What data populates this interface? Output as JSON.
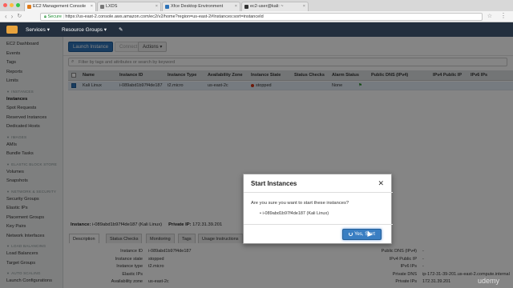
{
  "browser": {
    "tabs": [
      {
        "label": "EC2 Management Console"
      },
      {
        "label": "LXDS"
      },
      {
        "label": "Xfce Desktop Environment"
      },
      {
        "label": "ec2-user@kali: ~"
      }
    ],
    "secure_label": "Secure",
    "url": "https://us-east-2.console.aws.amazon.com/ec2/v2/home?region=us-east-2#Instances:sort=instanceId"
  },
  "aws_header": {
    "services": "Services",
    "resource_groups": "Resource Groups"
  },
  "sidebar": {
    "top_items": [
      "EC2 Dashboard",
      "Events",
      "Tags",
      "Reports",
      "Limits"
    ],
    "sections": [
      {
        "title": "INSTANCES",
        "items": [
          "Instances",
          "Spot Requests",
          "Reserved Instances",
          "Dedicated Hosts"
        ]
      },
      {
        "title": "IMAGES",
        "items": [
          "AMIs",
          "Bundle Tasks"
        ]
      },
      {
        "title": "ELASTIC BLOCK STORE",
        "items": [
          "Volumes",
          "Snapshots"
        ]
      },
      {
        "title": "NETWORK & SECURITY",
        "items": [
          "Security Groups",
          "Elastic IPs",
          "Placement Groups",
          "Key Pairs",
          "Network Interfaces"
        ]
      },
      {
        "title": "LOAD BALANCING",
        "items": [
          "Load Balancers",
          "Target Groups"
        ]
      },
      {
        "title": "AUTO SCALING",
        "items": [
          "Launch Configurations"
        ]
      }
    ],
    "selected": "Instances"
  },
  "toolbar": {
    "launch": "Launch Instance",
    "connect": "Connect",
    "actions": "Actions"
  },
  "filter": {
    "placeholder": "Filter by tags and attributes or search by keyword"
  },
  "table": {
    "headers": [
      "Name",
      "Instance ID",
      "Instance Type",
      "Availability Zone",
      "Instance State",
      "Status Checks",
      "Alarm Status",
      "Public DNS (IPv4)",
      "IPv4 Public IP",
      "IPv6 IPs"
    ],
    "rows": [
      {
        "name": "Kali Linux",
        "instance_id": "i-089abd1b97f4de187",
        "type": "t2.micro",
        "az": "us-east-2c",
        "state": "stopped",
        "status_checks": "",
        "alarm": "None",
        "dns": "",
        "ipv4": "",
        "ipv6": ""
      }
    ]
  },
  "infobar": {
    "instance_label": "Instance:",
    "instance_value": "i-089abd1b97f4de187 (Kali Linux)",
    "private_ip_label": "Private IP:",
    "private_ip_value": "172.31.39.201"
  },
  "detail_tabs": [
    "Description",
    "Status Checks",
    "Monitoring",
    "Tags",
    "Usage Instructions"
  ],
  "details_left": [
    {
      "label": "Instance ID",
      "value": "i-089abd1b97f4de187"
    },
    {
      "label": "Instance state",
      "value": "stopped"
    },
    {
      "label": "Instance type",
      "value": "t2.micro"
    },
    {
      "label": "Elastic IPs",
      "value": ""
    },
    {
      "label": "Availability zone",
      "value": "us-east-2c"
    }
  ],
  "details_right": [
    {
      "label": "Public DNS (IPv4)",
      "value": "-"
    },
    {
      "label": "IPv4 Public IP",
      "value": "-"
    },
    {
      "label": "IPv6 IPs",
      "value": "-"
    },
    {
      "label": "Private DNS",
      "value": "ip-172-31-39-201.us-east-2.compute.internal"
    },
    {
      "label": "Private IPs",
      "value": "172.31.39.201"
    }
  ],
  "modal": {
    "title": "Start Instances",
    "close_glyph": "✕",
    "question": "Are you sure you want to start these instances?",
    "item": "i-089abd1b97f4de187 (Kali Linux)",
    "confirm": "Yes, Start"
  },
  "watermark": "udemy",
  "colors": {
    "aws_nav": "#232f3e",
    "primary_button": "#2e73b8",
    "stopped": "#d13212",
    "selected_row": "#e3ecf6"
  }
}
